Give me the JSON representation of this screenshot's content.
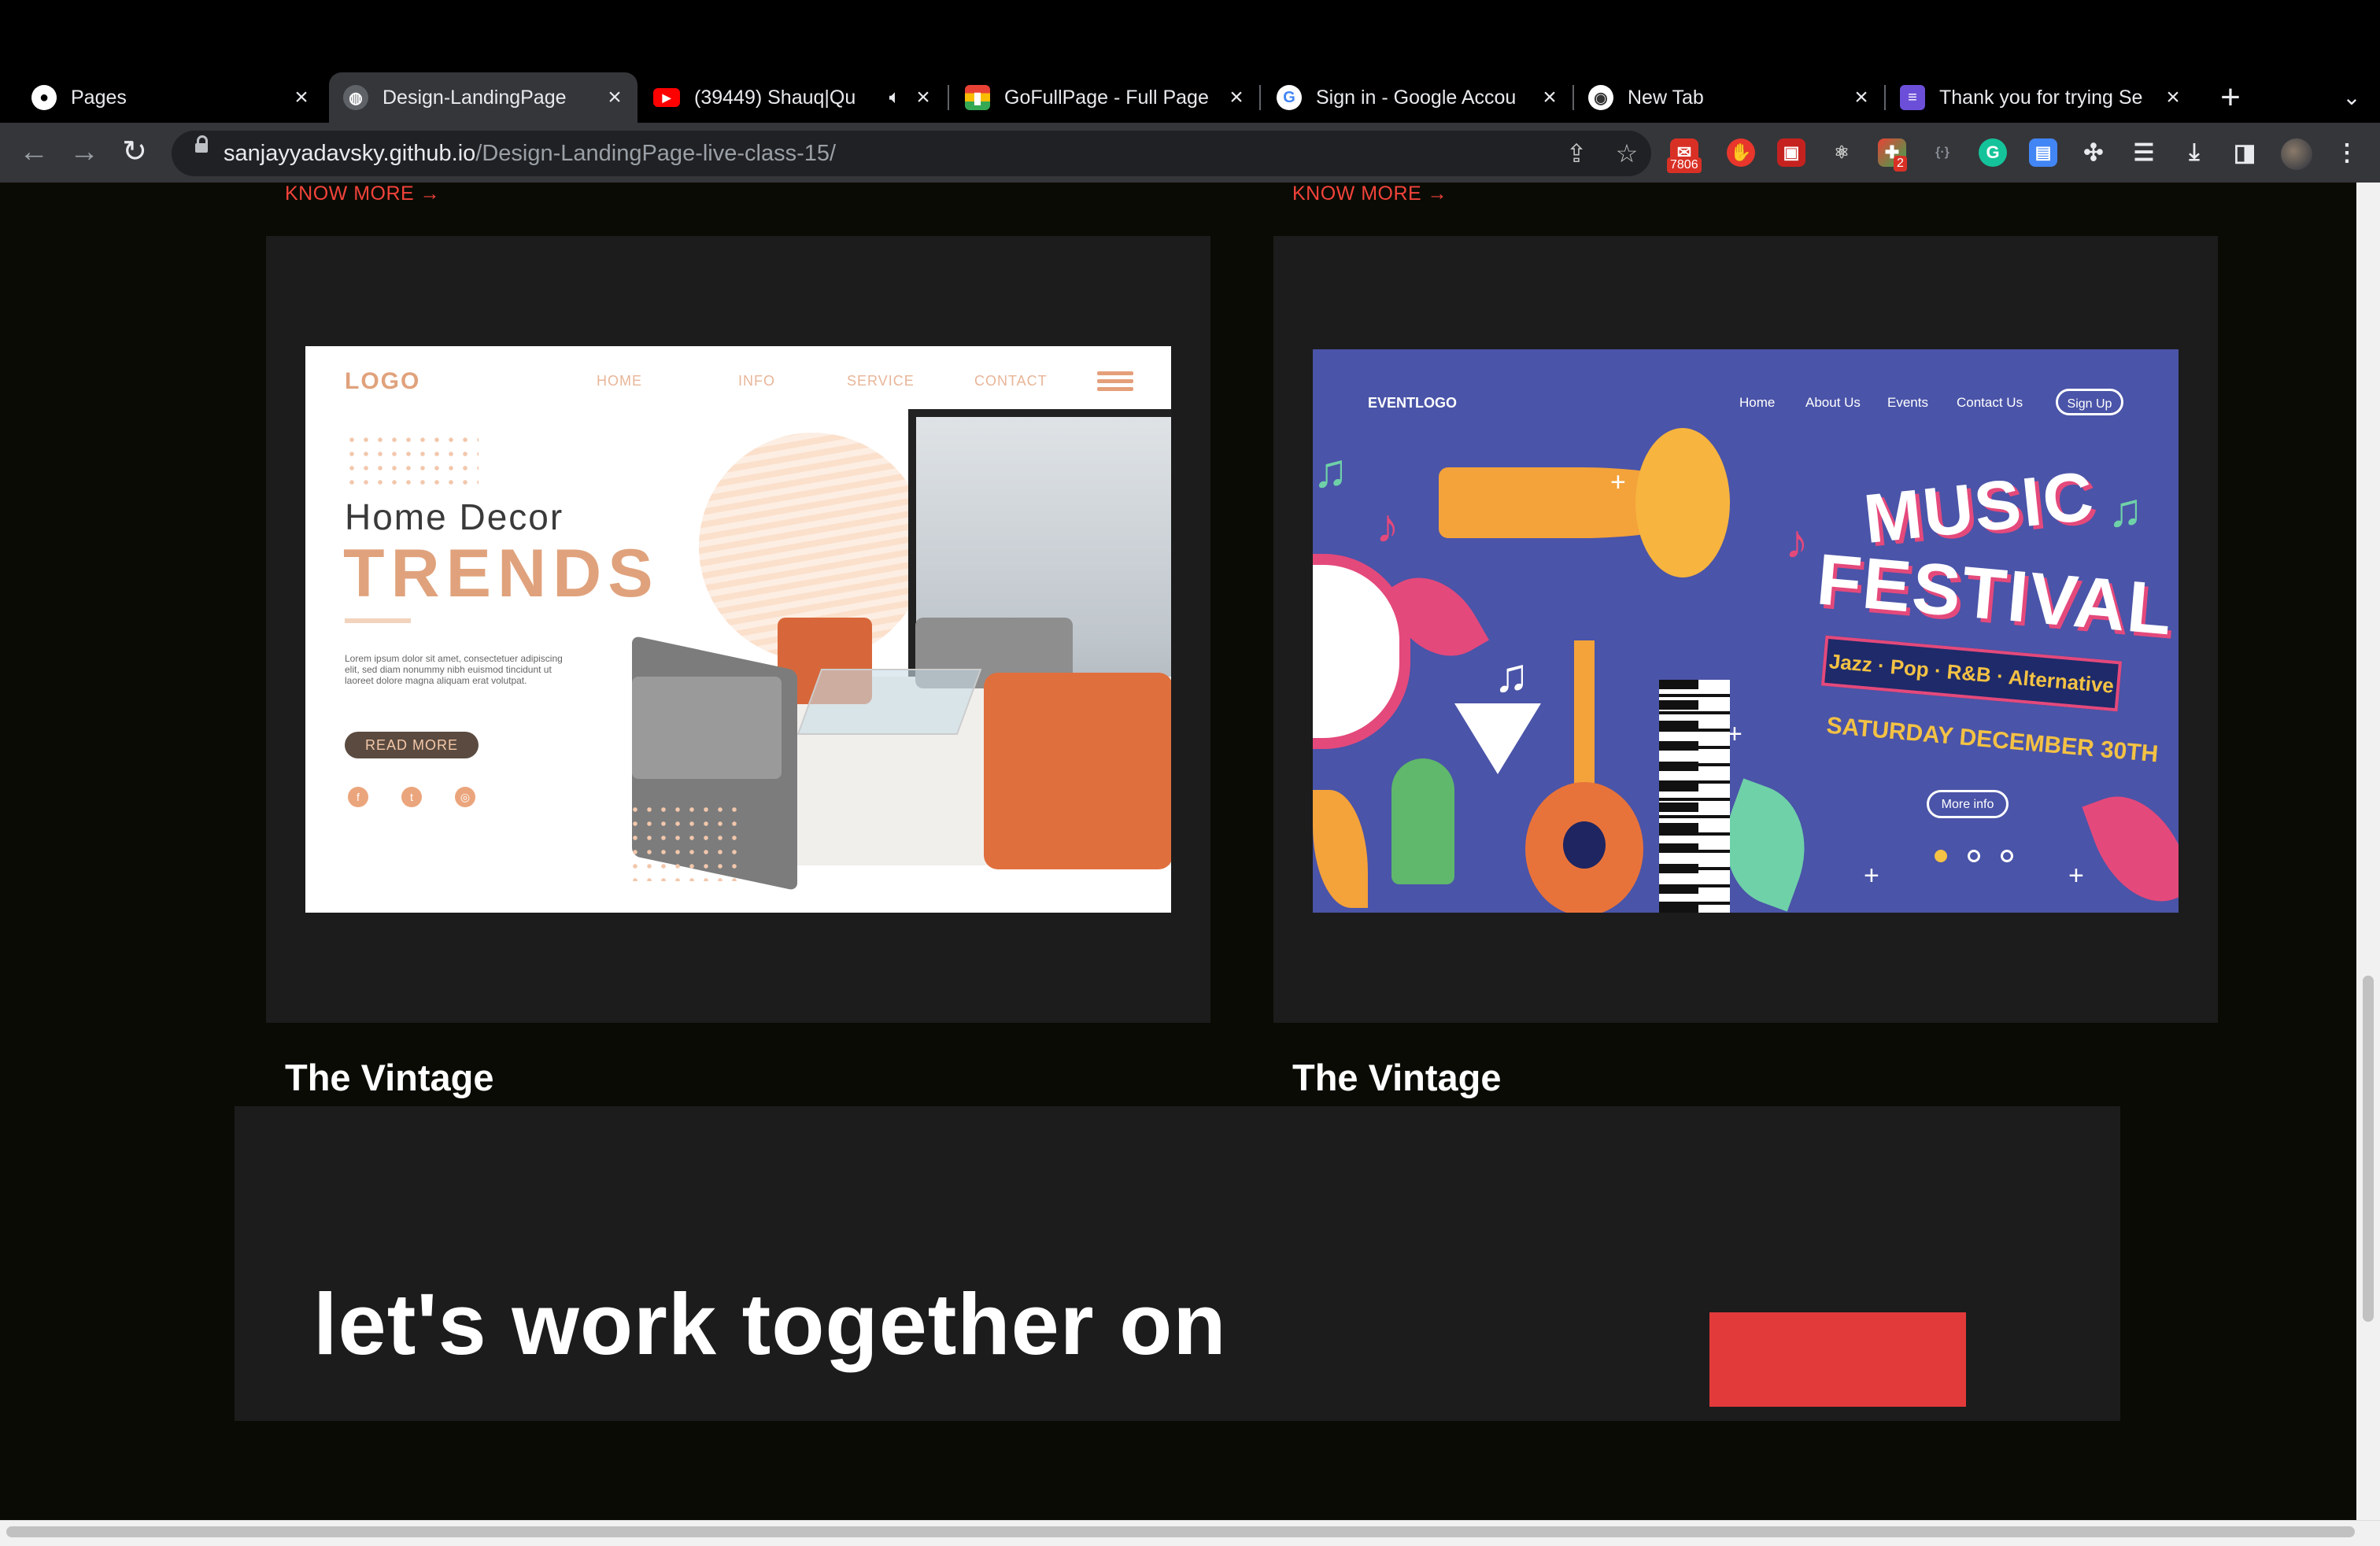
{
  "browser": {
    "tabs": [
      {
        "label": "Pages",
        "icon": "github-icon"
      },
      {
        "label": "Design-LandingPage",
        "icon": "globe-icon",
        "active": true
      },
      {
        "label": "(39449) Shauq|Qu",
        "icon": "youtube-icon",
        "audio": true
      },
      {
        "label": "GoFullPage - Full Page",
        "icon": "gofullpage-icon"
      },
      {
        "label": "Sign in - Google Accou",
        "icon": "google-icon"
      },
      {
        "label": "New Tab",
        "icon": "chrome-icon"
      },
      {
        "label": "Thank you for trying Se",
        "icon": "app-icon"
      }
    ],
    "url_host": "sanjayyadavsky.github.io",
    "url_path": "/Design-LandingPage-live-class-15/",
    "extensions": {
      "mail_badge": "7806",
      "grid_badge": "2"
    }
  },
  "page": {
    "know_more_label": "KNOW MORE",
    "arrow": "→",
    "projects": [
      {
        "title": "The Vintage",
        "preview": {
          "logo": "LOGO",
          "nav": [
            "HOME",
            "INFO",
            "SERVICE",
            "CONTACT"
          ],
          "heading": "Home  Decor",
          "subheading": "TRENDS",
          "body": "Lorem ipsum dolor sit amet, consectetuer adipiscing elit, sed diam nonummy nibh euismod tincidunt ut laoreet dolore magna aliquam erat volutpat.",
          "button": "READ MORE"
        }
      },
      {
        "title": "The Vintage",
        "preview": {
          "logo": "EVENTLOGO",
          "nav": [
            "Home",
            "About Us",
            "Events",
            "Contact Us"
          ],
          "signup": "Sign Up",
          "title1": "MUSIC",
          "title2": "FESTIVAL",
          "genres": "Jazz · Pop · R&B · Alternative",
          "date": "SATURDAY DECEMBER 30TH",
          "button": "More info"
        }
      }
    ],
    "cta_heading": "let's work together on"
  },
  "colors": {
    "accent": "#f2433a",
    "page_bg": "#0b0b05",
    "card_bg": "#1c1c1c"
  }
}
